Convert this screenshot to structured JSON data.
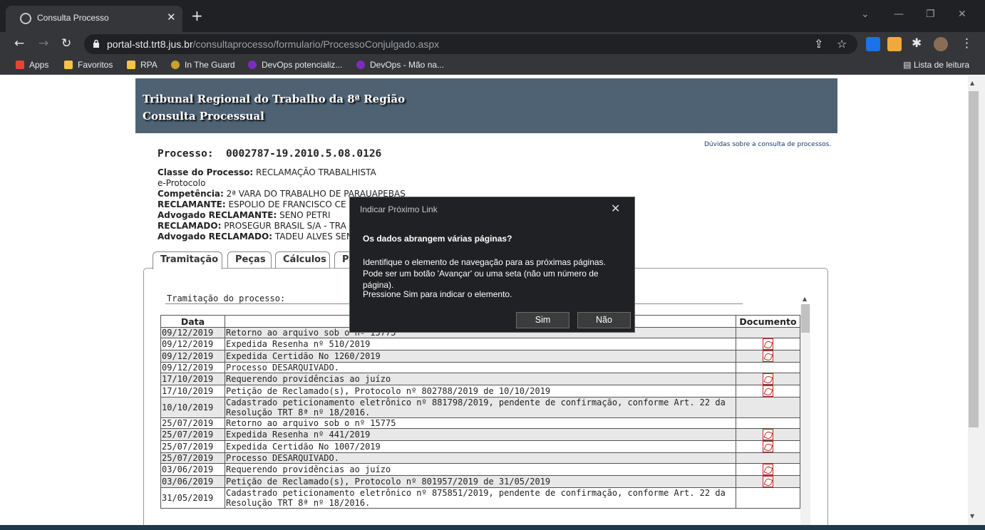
{
  "browser": {
    "tab_title": "Consulta Processo",
    "url_host": "portal-std.trt8.jus.br",
    "url_path": "/consultaprocesso/formulario/ProcessoConjulgado.aspx",
    "bookmarks": [
      "Apps",
      "Favoritos",
      "RPA",
      "In The Guard",
      "DevOps potencializ...",
      "DevOps - Mão na..."
    ],
    "reading_list": "Lista de leitura"
  },
  "header": {
    "line1": "Tribunal Regional do Trabalho da 8ª Região",
    "line2": "Consulta Processual",
    "help_link": "Dúvidas sobre a consulta de processos."
  },
  "processo": {
    "label": "Processo:",
    "number": "0002787-19.2010.5.08.0126",
    "classe_label": "Classe do Processo:",
    "classe_value": "RECLAMAÇÃO TRABALHISTA",
    "protocolo": "e-Protocolo",
    "competencia_label": "Competência:",
    "competencia_value": "2ª VARA DO TRABALHO DE PARAUAPEBAS",
    "reclamante_label": "RECLAMANTE:",
    "reclamante_value": "ESPOLIO DE FRANCISCO CE",
    "adv_reclamante_label": "Advogado RECLAMANTE:",
    "adv_reclamante_value": "SENO PETRI",
    "reclamado_label": "RECLAMADO:",
    "reclamado_value": "PROSEGUR BRASIL S/A - TRA",
    "adv_reclamado_label": "Advogado RECLAMADO:",
    "adv_reclamado_value": "TADEU ALVES SEN"
  },
  "tabs": [
    "Tramitação",
    "Peças",
    "Cálculos",
    "Pa"
  ],
  "tramitacao": {
    "label": "Tramitação do processo:",
    "headers": {
      "date": "Data",
      "desc": "",
      "doc": "Documento"
    },
    "rows": [
      {
        "date": "09/12/2019",
        "desc": "Retorno ao arquivo sob o nº 15775",
        "doc": false
      },
      {
        "date": "09/12/2019",
        "desc": "Expedida Resenha nº 510/2019",
        "doc": true
      },
      {
        "date": "09/12/2019",
        "desc": "Expedida Certidão No 1260/2019",
        "doc": true
      },
      {
        "date": "09/12/2019",
        "desc": "Processo DESARQUIVADO.",
        "doc": false
      },
      {
        "date": "17/10/2019",
        "desc": "Requerendo providências ao juízo",
        "doc": true
      },
      {
        "date": "17/10/2019",
        "desc": "Petição de Reclamado(s), Protocolo nº 802788/2019 de 10/10/2019",
        "doc": true
      },
      {
        "date": "10/10/2019",
        "desc": "Cadastrado peticionamento eletrônico nº 881798/2019, pendente de confirmação, conforme Art. 22 da Resolução TRT 8ª nº 18/2016.",
        "doc": false
      },
      {
        "date": "25/07/2019",
        "desc": "Retorno ao arquivo sob o nº 15775",
        "doc": false
      },
      {
        "date": "25/07/2019",
        "desc": "Expedida Resenha nº 441/2019",
        "doc": true
      },
      {
        "date": "25/07/2019",
        "desc": "Expedida Certidão No 1007/2019",
        "doc": true
      },
      {
        "date": "25/07/2019",
        "desc": "Processo DESARQUIVADO.",
        "doc": false
      },
      {
        "date": "03/06/2019",
        "desc": "Requerendo providências ao juízo",
        "doc": true
      },
      {
        "date": "03/06/2019",
        "desc": "Petição de Reclamado(s), Protocolo nº 801957/2019 de 31/05/2019",
        "doc": true
      },
      {
        "date": "31/05/2019",
        "desc": "Cadastrado peticionamento eletrônico nº 875851/2019, pendente de confirmação, conforme Art. 22 da Resolução TRT 8ª nº 18/2016.",
        "doc": false
      }
    ]
  },
  "dialog": {
    "title": "Indicar Próximo Link",
    "question": "Os dados abrangem várias páginas?",
    "body": "Identifique o elemento de navegação para as próximas páginas. Pode ser um botão 'Avançar' ou uma seta (não um número de página).",
    "instruction": "Pressione Sim para indicar o elemento.",
    "yes": "Sim",
    "no": "Não"
  },
  "colors": {
    "header_bg": "#4f6274",
    "dialog_bg": "#202124",
    "pdf_icon": "#cc2222"
  }
}
